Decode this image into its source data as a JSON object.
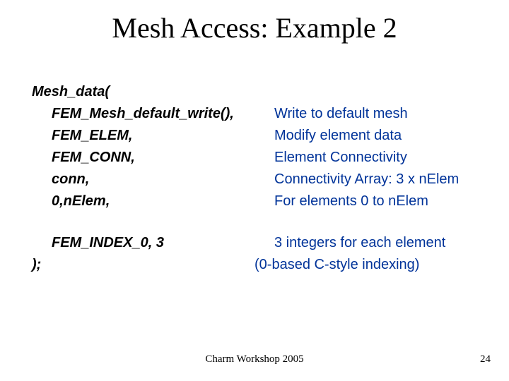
{
  "title": "Mesh Access: Example 2",
  "rows": [
    {
      "code": "Mesh_data(",
      "desc": "",
      "indent": false
    },
    {
      "code": "FEM_Mesh_default_write(),",
      "desc": "Write to default mesh",
      "indent": true
    },
    {
      "code": "FEM_ELEM,",
      "desc": "Modify element data",
      "indent": true
    },
    {
      "code": "FEM_CONN,",
      "desc": "Element Connectivity",
      "indent": true
    },
    {
      "code": "conn,",
      "desc": "Connectivity Array: 3 x nElem",
      "indent": true
    },
    {
      "code": "0,nElem,",
      "desc": "For elements 0 to nElem",
      "indent": true
    },
    {
      "gap": true
    },
    {
      "code": "FEM_INDEX_0, 3",
      "desc": "3 integers for each element",
      "indent": true
    },
    {
      "code": ");",
      "desc": "(0-based C-style indexing)",
      "indent": false
    }
  ],
  "footer": {
    "left": "Charm Workshop 2005",
    "right": "24"
  }
}
